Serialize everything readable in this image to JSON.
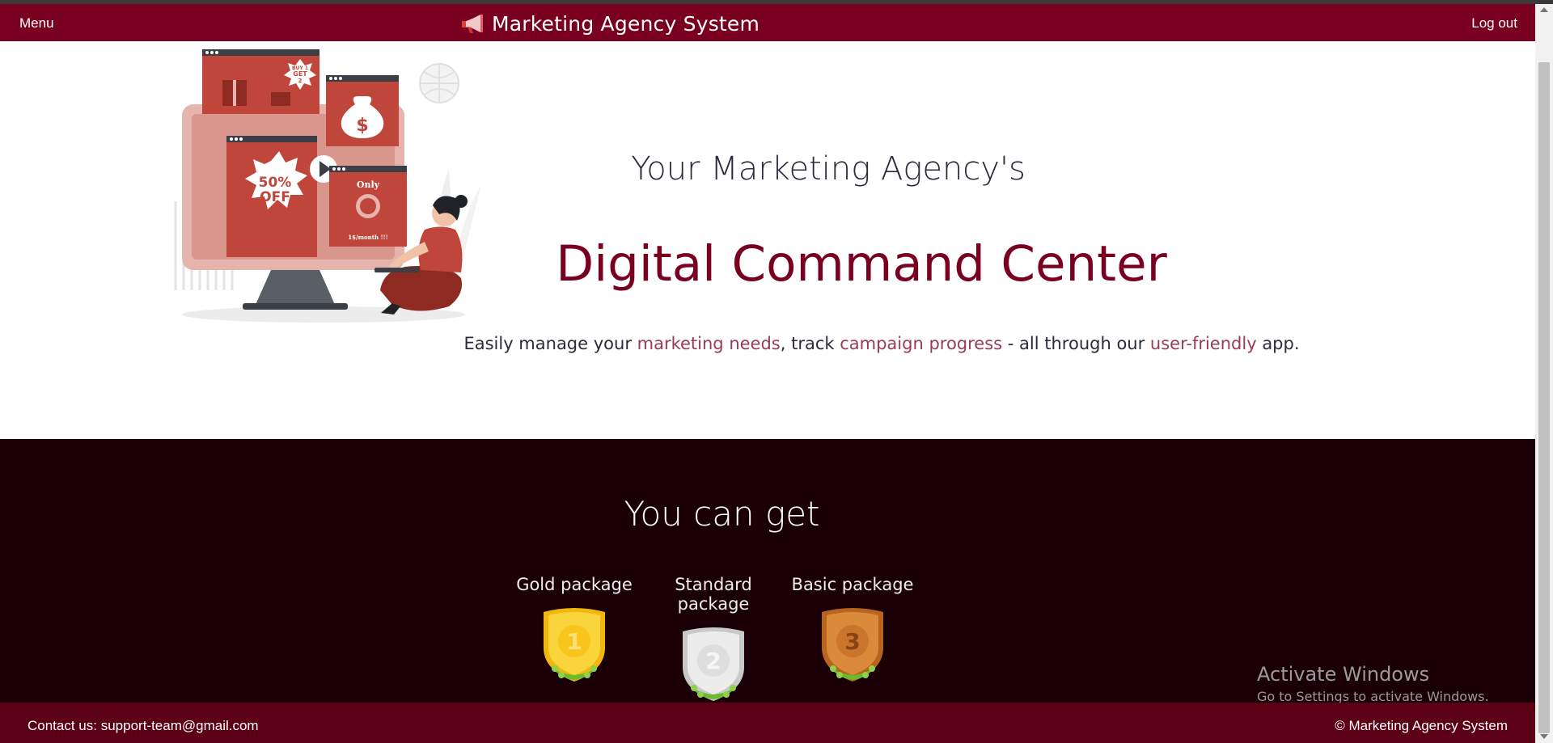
{
  "navbar": {
    "menu_label": "Menu",
    "brand_text": "Marketing Agency System",
    "logout_label": "Log out",
    "brand_icon": "megaphone-icon"
  },
  "hero": {
    "subtitle": "Your Marketing Agency's",
    "title": "Digital Command Center",
    "desc_part1": "Easily manage your ",
    "desc_hl1": "marketing needs",
    "desc_part2": ", track ",
    "desc_hl2": "campaign progress",
    "desc_part3": " - all through our ",
    "desc_hl3": "user-friendly",
    "desc_part4": " app.",
    "illustration": {
      "promo_buy": "BUY 1",
      "promo_get": "GET",
      "promo_num": "2",
      "sale_pct": "50%",
      "sale_off": "OFF",
      "only_label": "Only",
      "price_label": "1$/month !!!",
      "dollar_sign": "$"
    }
  },
  "packages": {
    "title": "You can get",
    "items": [
      {
        "label": "Gold package",
        "rank": "1",
        "color": "#f5c518"
      },
      {
        "label": "Standard package",
        "rank": "2",
        "color": "#d9d9d9"
      },
      {
        "label": "Basic package",
        "rank": "3",
        "color": "#d07a2a"
      }
    ]
  },
  "watermark": {
    "title": "Activate Windows",
    "subtitle": "Go to Settings to activate Windows."
  },
  "footer": {
    "contact": "Contact us: support-team@gmail.com",
    "copyright": "© Marketing Agency System"
  },
  "colors": {
    "brand": "#7a0020",
    "dark_section": "#1a0006",
    "footer": "#5c0016",
    "highlight": "#9a3b52"
  }
}
